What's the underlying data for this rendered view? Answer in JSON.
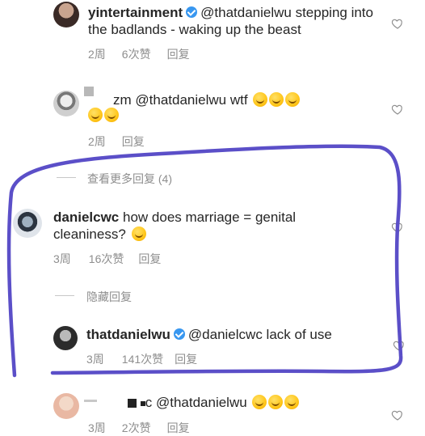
{
  "comments": [
    {
      "username": "yintertainment",
      "verified": true,
      "text": "@thatdanielwu stepping into the badlands - waking up the beast",
      "time": "2周",
      "likes": "6次赞",
      "reply": "回复"
    },
    {
      "username": "zm",
      "text": "@thatdanielwu wtf",
      "emoji_count": 5,
      "time": "2周",
      "reply": "回复"
    },
    {
      "view_more_replies": "查看更多回复 (4)",
      "username": "danielcwc",
      "text": "how does marriage = genital cleaniness?",
      "emoji_count": 1,
      "time": "3周",
      "likes": "16次赞",
      "reply": "回复",
      "hide_replies": "隐藏回复"
    },
    {
      "username": "thatdanielwu",
      "verified": true,
      "text": "@danielcwc lack of use",
      "time": "3周",
      "likes": "141次赞",
      "reply": "回复"
    },
    {
      "username": "c",
      "text": "@thatdanielwu",
      "emoji_count": 3,
      "time": "3周",
      "likes": "2次赞",
      "reply": "回复"
    }
  ],
  "annotation": {
    "color": "#5b4fc8",
    "shape": "hand-drawn loop around danielcwc thread"
  },
  "icons": {
    "like": "heart-outline-icon"
  },
  "colors": {
    "text": "#262626",
    "meta": "#8e8e8e",
    "verified": "#3897f0"
  }
}
